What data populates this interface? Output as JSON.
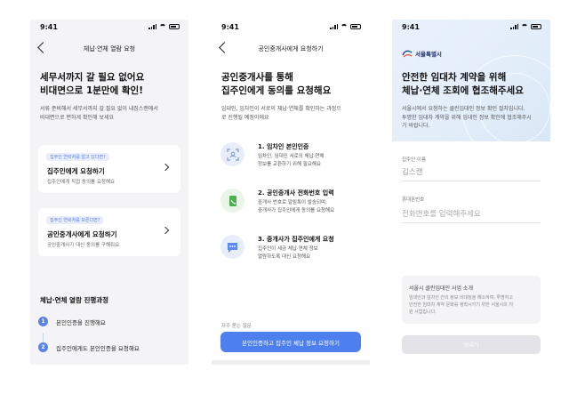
{
  "status": {
    "time": "9:41"
  },
  "screen1": {
    "nav_title": "체납·연체 열람 요청",
    "headline": [
      "세무서까지 갈 필요 없어요",
      "비대면으로 1분만에 확인!"
    ],
    "desc": [
      "서류 준비해서 세무서까지 갈 필요 없이 내집스캔에서",
      "비대면으로 편하게 확인해 보세요"
    ],
    "cards": [
      {
        "tag": "집주인 연락처를 알고 있다면?",
        "title": "집주인에게 요청하기",
        "subtitle": "집주인에게 직접 동의를 요청해요"
      },
      {
        "tag": "집주인 연락처를 모른다면?",
        "title": "공인중개사에게 요청하기",
        "subtitle": "공인중개사가 대신 동의를 구해줘요"
      }
    ],
    "process_title": "체납·연체 열람 진행과정",
    "steps": [
      {
        "num": "1",
        "label": "본인인증을 진행해요"
      },
      {
        "num": "2",
        "label": "집주인에게도 본인인증을 요청해요"
      }
    ]
  },
  "screen2": {
    "nav_title": "공인중개사에게 요청하기",
    "headline": [
      "공인중개사를 통해",
      "집주인에게 동의를 요청해요"
    ],
    "desc": [
      "임대인, 임차인이 서로의 체납·연체를 확인하는 과정으",
      "로 진행될 예정이에요"
    ],
    "steps": [
      {
        "title": "1. 임차인 본인인증",
        "desc": [
          "임차인, 임대인 서로의 체납·연체",
          "정보를 교환하기 위해 필요해요"
        ],
        "icon": "scan-icon"
      },
      {
        "title": "2. 공인중개사 전화번호 입력",
        "desc": [
          "중개사 번호로 알림톡이 발송되며,",
          "중개사가 집주인에게 동의를 요청해요"
        ],
        "icon": "phone-icon"
      },
      {
        "title": "3. 중개사가 집주인에게 요청",
        "desc": [
          "집주인이 세금 체납·연체 정보",
          "열람하도록 대신 요청해요"
        ],
        "icon": "chat-icon"
      }
    ],
    "faq_label": "자주 묻는 질문",
    "cta_label": "본인인증하고 집주인 체납 정보 요청하기"
  },
  "screen3": {
    "logo_text": "서울특별시",
    "headline": [
      "안전한 임대차 계약을 위해",
      "체납·연체 조회에 협조해주세요"
    ],
    "desc": [
      "서울시에서 요청하는 클린임대인 정보 확인 절차입니다.",
      "투명한 임대차 계약을 위해 임대인 정보 확인에 협조해주시",
      "기 바랍니다."
    ],
    "name_label": "집주인 이름",
    "name_value": "김스캔",
    "phone_label": "휴대폰번호",
    "phone_placeholder": "전화번호를 입력해주세요",
    "notice_title": "서울시 클린임대인 사업 소개",
    "notice_desc": [
      "임대인과 임차인 간의 정보 비대칭을 해소하여, 투명하고",
      "안전한 임대차 계약 문화를 정착시키기 위한 서울시의 지",
      "원 사업입니다."
    ],
    "submit_label": "보내기"
  },
  "colors": {
    "accent": "#4d7fef",
    "disabled": "#e3e3e8"
  }
}
